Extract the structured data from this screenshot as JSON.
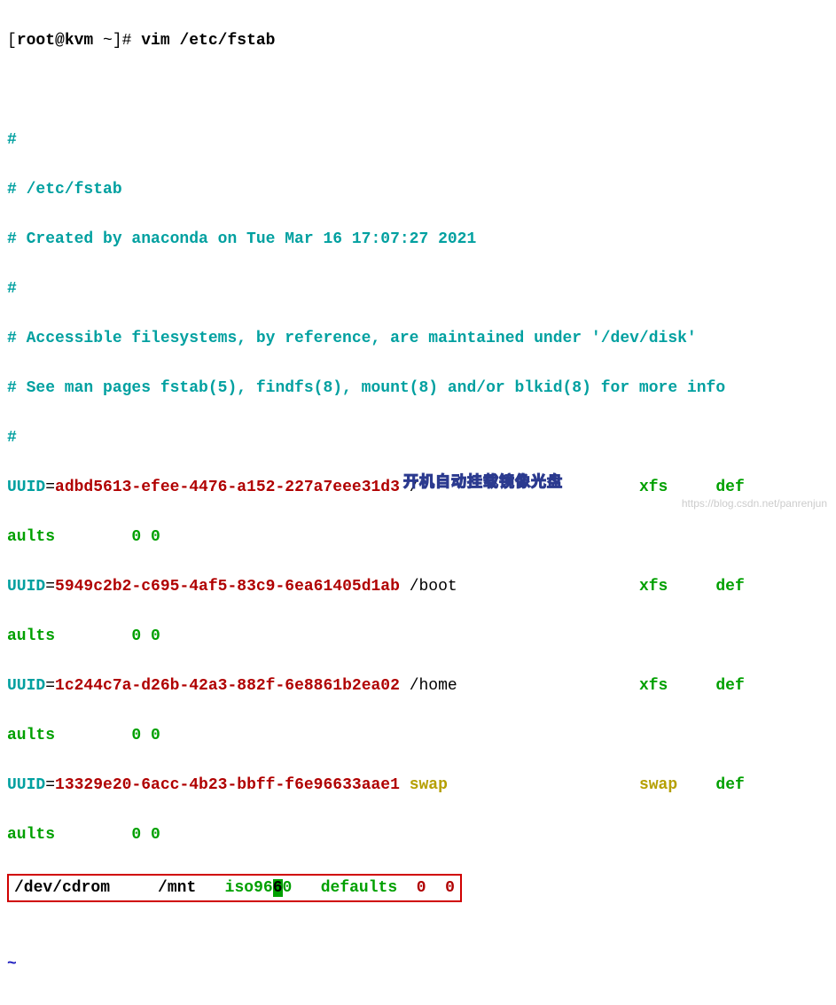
{
  "prompt": {
    "open": "[",
    "user": "root@kvm",
    "path": " ~",
    "close": "]# ",
    "command": "vim /etc/fstab"
  },
  "blank1": "",
  "blank2": "",
  "comments": {
    "c1": "#",
    "c2": "# /etc/fstab",
    "c3": "# Created by anaconda on Tue Mar 16 17:07:27 2021",
    "c4": "#",
    "c5": "# Accessible filesystems, by reference, are maintained under '/dev/disk'",
    "c6": "# See man pages fstab(5), findfs(8), mount(8) and/or blkid(8) for more info",
    "c7": "#"
  },
  "entries": [
    {
      "key": "UUID",
      "eq": "=",
      "value": "adbd5613-efee-4476-a152-227a7eee31d3",
      "mount": " /                       ",
      "fs": "xfs",
      "pad": "     ",
      "opts": "def",
      "tail": "aults        0 0"
    },
    {
      "key": "UUID",
      "eq": "=",
      "value": "5949c2b2-c695-4af5-83c9-6ea61405d1ab",
      "mount": " /boot                   ",
      "fs": "xfs",
      "pad": "     ",
      "opts": "def",
      "tail": "aults        0 0"
    },
    {
      "key": "UUID",
      "eq": "=",
      "value": "1c244c7a-d26b-42a3-882f-6e8861b2ea02",
      "mount": " /home                   ",
      "fs": "xfs",
      "pad": "     ",
      "opts": "def",
      "tail": "aults        0 0"
    },
    {
      "key": "UUID",
      "eq": "=",
      "value": "13329e20-6acc-4b23-bbff-f6e96633aae1",
      "mount_swap": " swap                    ",
      "fs_swap": "swap",
      "pad": "    ",
      "opts": "def",
      "tail": "aults        0 0"
    }
  ],
  "highlighted_line": {
    "dev": "/dev/cdrom",
    "gap1": "     ",
    "mnt": "/mnt",
    "gap2": "   ",
    "fs_pre": "iso96",
    "fs_cursor": "6",
    "fs_post": "0",
    "gap3": "   ",
    "defaults": "defaults",
    "gap4": "  ",
    "zero1": "0",
    "gap5": "  ",
    "zero2": "0"
  },
  "tilde": "~",
  "note": "开机自动挂载镜像光盘",
  "watermark": "https://blog.csdn.net/panrenjun"
}
